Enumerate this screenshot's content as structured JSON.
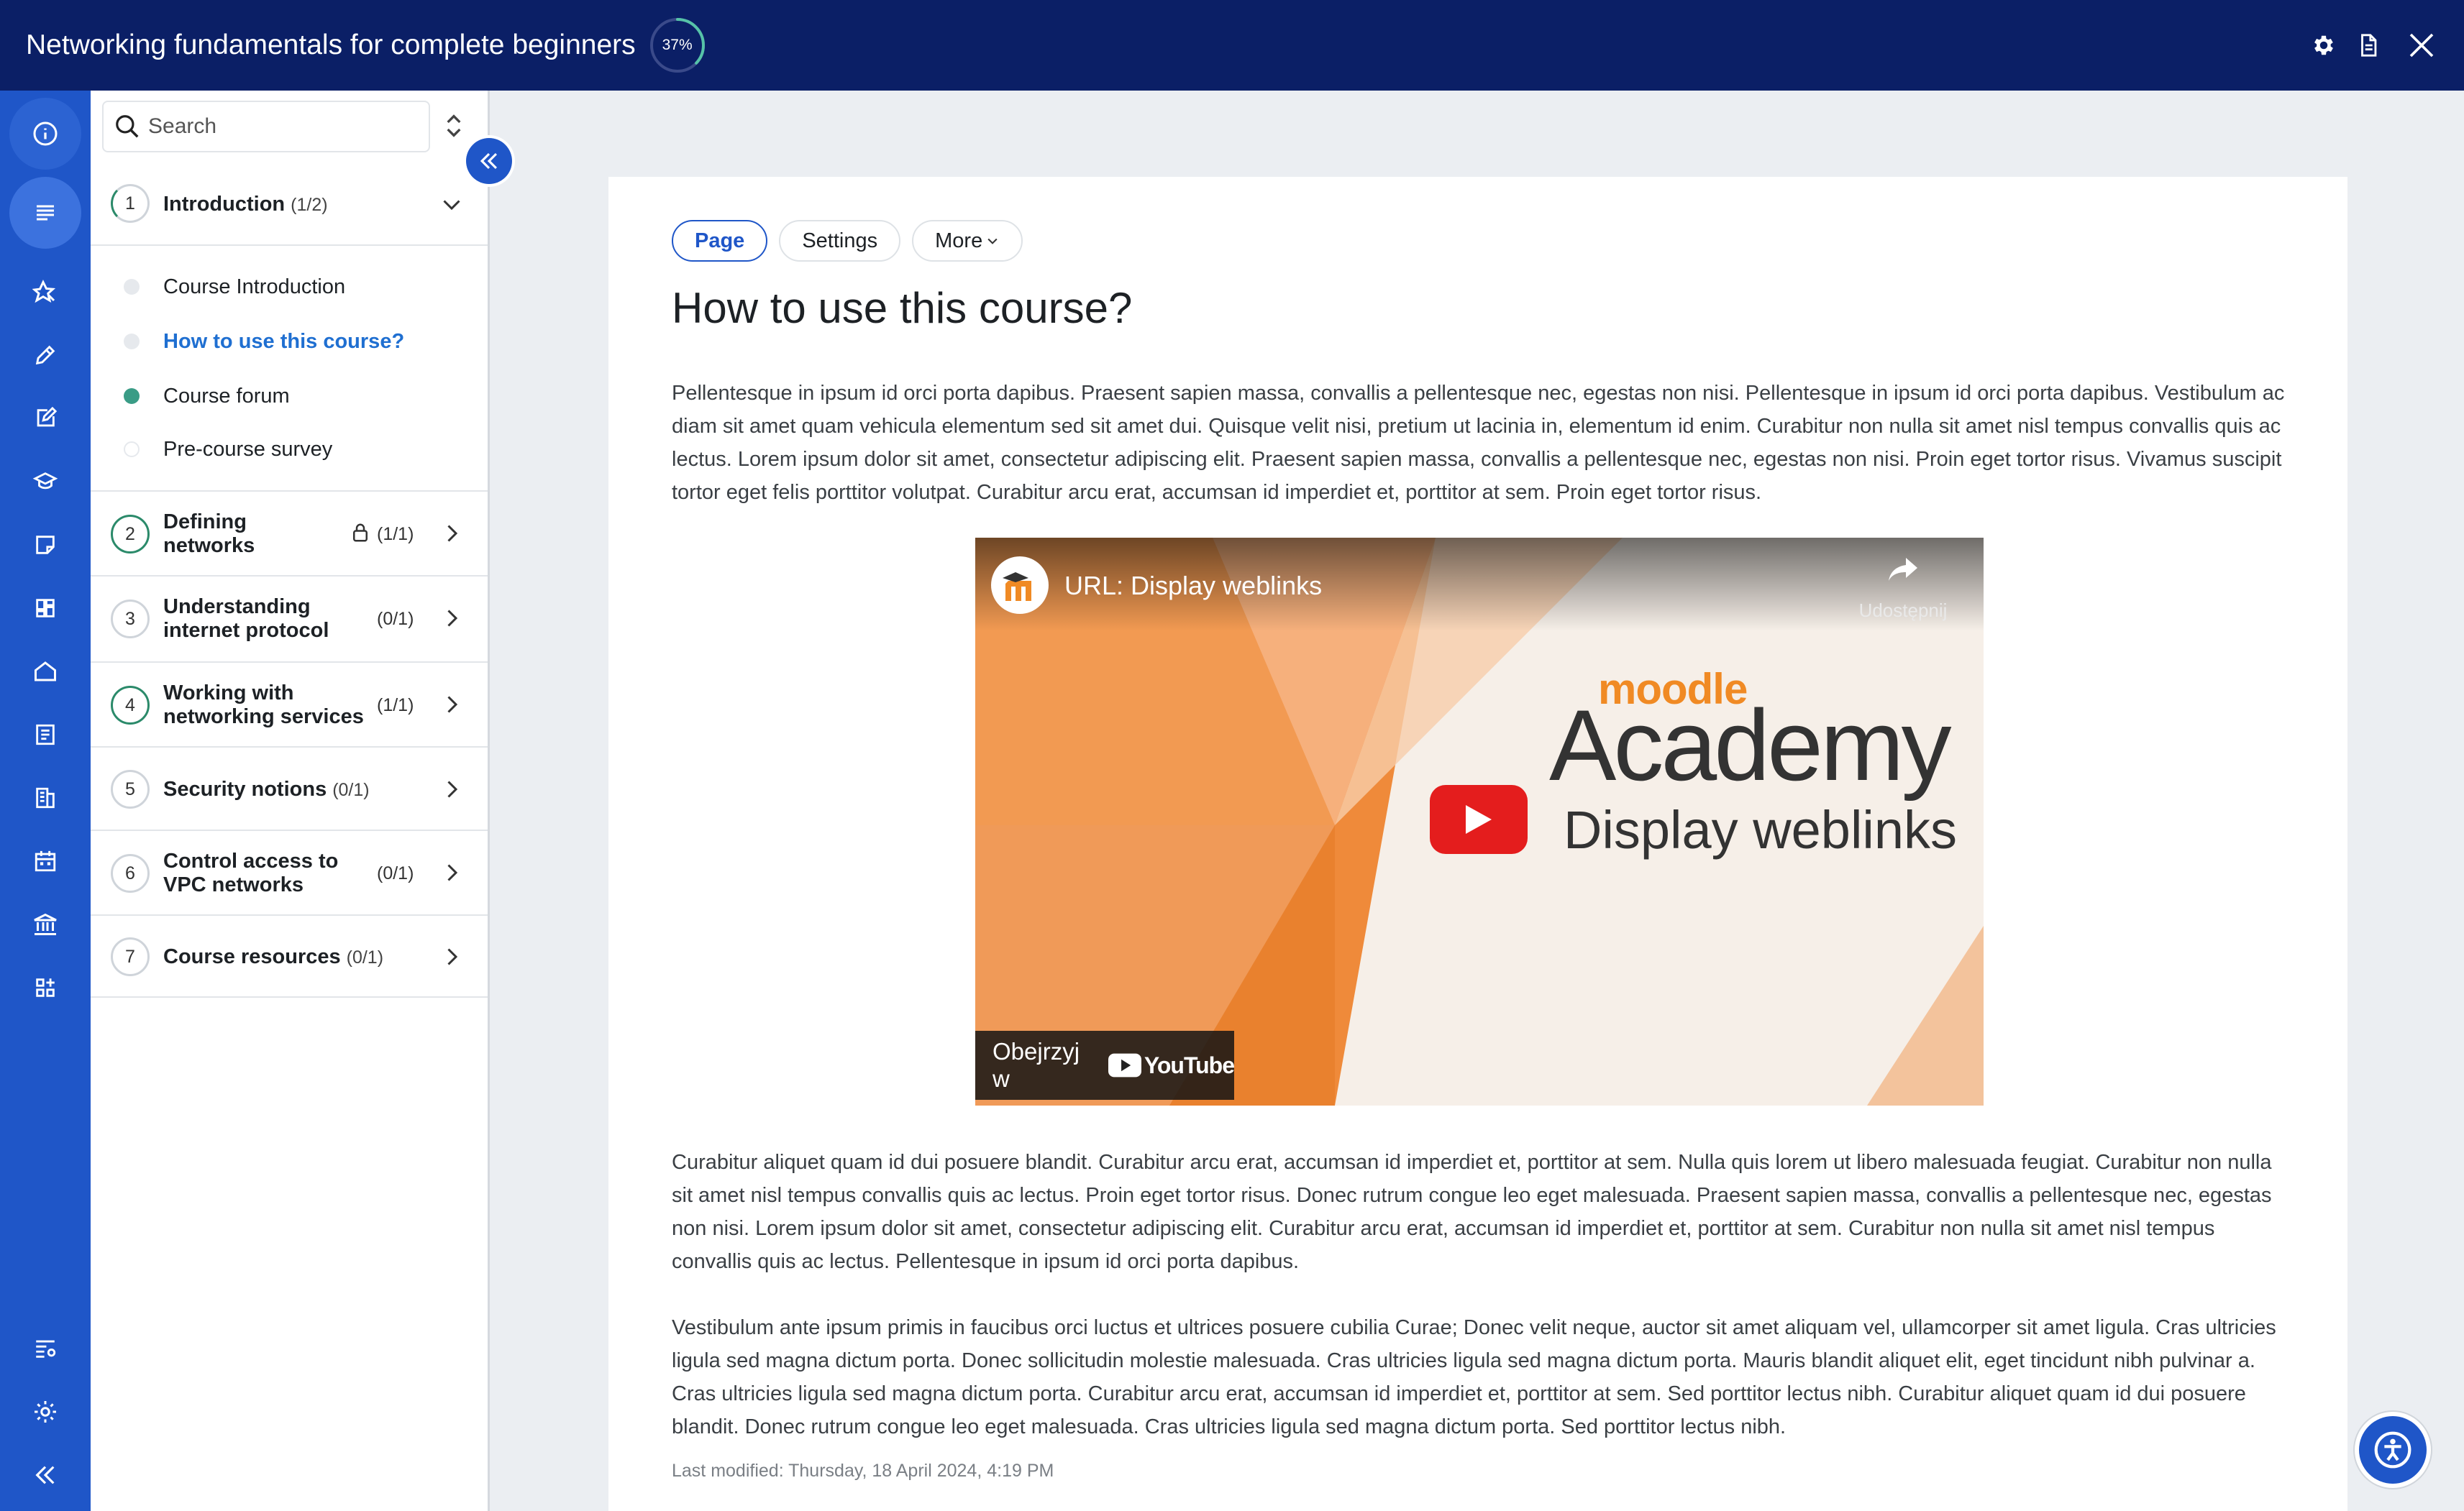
{
  "header": {
    "course_title": "Networking fundamentals for complete beginners",
    "progress_percent": 37,
    "progress_label": "37%"
  },
  "rail": {
    "icons": [
      "info-icon",
      "course-index-icon",
      "badge-icon",
      "pencil-icon",
      "edit-note-icon",
      "graduation-cap-icon",
      "sticky-note-icon",
      "dashboard-icon",
      "home-icon",
      "notes-icon",
      "reports-icon",
      "calendar-icon",
      "institution-icon",
      "apps-icon",
      "settings-list-icon",
      "gear-icon",
      "collapse-icon"
    ]
  },
  "drawer": {
    "search_placeholder": "Search",
    "sections": [
      {
        "num": "1",
        "title": "Introduction",
        "count": "(1/2)",
        "state": "partial",
        "expanded": true,
        "activities": [
          {
            "label": "Course Introduction",
            "status": "not-started"
          },
          {
            "label": "How to use this course?",
            "status": "current"
          },
          {
            "label": "Course forum",
            "status": "complete"
          },
          {
            "label": "Pre-course survey",
            "status": "empty"
          }
        ]
      },
      {
        "num": "2",
        "title_line1": "Defining",
        "title_line2": "networks",
        "count": "(1/1)",
        "state": "done",
        "locked": true
      },
      {
        "num": "3",
        "title_line1": "Understanding",
        "title_line2": "internet protocol",
        "count": "(0/1)",
        "state": "todo"
      },
      {
        "num": "4",
        "title_line1": "Working with",
        "title_line2": "networking services",
        "count": "(1/1)",
        "state": "done"
      },
      {
        "num": "5",
        "title": "Security notions",
        "count": "(0/1)",
        "state": "todo"
      },
      {
        "num": "6",
        "title_line1": "Control access to",
        "title_line2": "VPC networks",
        "count": "(0/1)",
        "state": "todo"
      },
      {
        "num": "7",
        "title": "Course resources",
        "count": "(0/1)",
        "state": "todo"
      }
    ]
  },
  "main": {
    "tabs": [
      {
        "label": "Page",
        "active": true
      },
      {
        "label": "Settings",
        "active": false
      },
      {
        "label": "More",
        "active": false
      }
    ],
    "heading": "How to use this course?",
    "paragraph1": "Pellentesque in ipsum id orci porta dapibus. Praesent sapien massa, convallis a pellentesque nec, egestas non nisi. Pellentesque in ipsum id orci porta dapibus. Vestibulum ac diam sit amet quam vehicula elementum sed sit amet dui. Quisque velit nisi, pretium ut lacinia in, elementum id enim. Curabitur non nulla sit amet nisl tempus convallis quis ac lectus. Lorem ipsum dolor sit amet, consectetur adipiscing elit. Praesent sapien massa, convallis a pellentesque nec, egestas non nisi. Proin eget tortor risus. Vivamus suscipit tortor eget felis porttitor volutpat. Curabitur arcu erat, accumsan id imperdiet et, porttitor at sem. Proin eget tortor risus.",
    "video": {
      "title": "URL: Display weblinks",
      "share_label": "Udostępnij",
      "brand_top": "moodle",
      "brand_main": "Academy",
      "subtitle": "Display weblinks",
      "watch_on": "Obejrzyj w",
      "youtube_wordmark": "YouTube"
    },
    "paragraph2": "Curabitur aliquet quam id dui posuere blandit. Curabitur arcu erat, accumsan id imperdiet et, porttitor at sem. Nulla quis lorem ut libero malesuada feugiat. Curabitur non nulla sit amet nisl tempus convallis quis ac lectus. Proin eget tortor risus. Donec rutrum congue leo eget malesuada. Praesent sapien massa, convallis a pellentesque nec, egestas non nisi. Lorem ipsum dolor sit amet, consectetur adipiscing elit. Curabitur arcu erat, accumsan id imperdiet et, porttitor at sem. Curabitur non nulla sit amet nisl tempus convallis quis ac lectus. Pellentesque in ipsum id orci porta dapibus.",
    "paragraph3": "Vestibulum ante ipsum primis in faucibus orci luctus et ultrices posuere cubilia Curae; Donec velit neque, auctor sit amet aliquam vel, ullamcorper sit amet ligula. Cras ultricies ligula sed magna dictum porta. Donec sollicitudin molestie malesuada. Cras ultricies ligula sed magna dictum porta. Mauris blandit aliquet elit, eget tincidunt nibh pulvinar a. Cras ultricies ligula sed magna dictum porta. Curabitur arcu erat, accumsan id imperdiet et, porttitor at sem. Sed porttitor lectus nibh. Curabitur aliquet quam id dui posuere blandit. Donec rutrum congue leo eget malesuada. Cras ultricies ligula sed magna dictum porta. Sed porttitor lectus nibh.",
    "last_modified": "Last modified: Thursday, 18 April 2024, 4:19 PM"
  },
  "colors": {
    "topbar": "#0b1f66",
    "rail": "#1f56c8",
    "accent": "#1f56c8",
    "complete": "#2b8a6a",
    "current_link": "#1f6fd1"
  }
}
